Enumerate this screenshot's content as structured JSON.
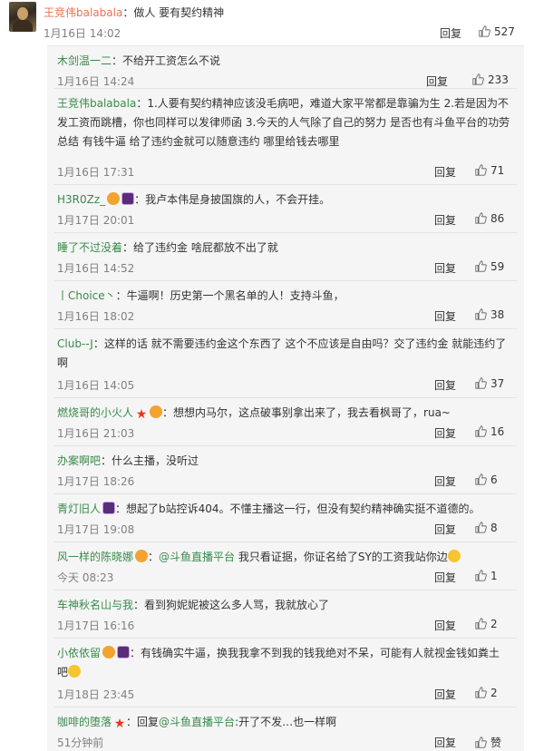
{
  "top_comment": {
    "author": "王竞伟balabala",
    "sep": "：",
    "text": "做人 要有契约精神",
    "time": "1月16日 14:02",
    "reply_label": "回复",
    "likes": "527"
  },
  "replies": [
    {
      "author": "木剑温一二",
      "sep": "：",
      "text": "不给开工资怎么不说",
      "time": "1月16日 14:24",
      "reply_label": "回复",
      "likes": "233"
    },
    {
      "author": "王竞伟balabala",
      "sep": "：",
      "text": "1.人要有契约精神应该没毛病吧，难道大家平常都是靠骗为生 2.若是因为不发工资而跳槽，你也同样可以发律师函 3.今天的人气除了自己的努力 是否也有斗鱼平台的功劳总结 有钱牛逼 给了违约金就可以随意违约 哪里给钱去哪里",
      "time": "1月16日 17:31",
      "reply_label": "回复",
      "likes": "71"
    },
    {
      "author": "H3R0Zz_",
      "sep": "：",
      "text": "我卢本伟是身披国旗的人，不会开挂。",
      "time": "1月17日 20:01",
      "reply_label": "回复",
      "likes": "86"
    },
    {
      "author": "睡了不过没着",
      "sep": "：",
      "text": "给了违约金 啥屁都放不出了就",
      "time": "1月16日 14:52",
      "reply_label": "回复",
      "likes": "59"
    },
    {
      "author": "丨Choice丶",
      "sep": "：",
      "text": "牛逼啊！历史第一个黑名单的人！支持斗鱼，",
      "time": "1月16日 18:02",
      "reply_label": "回复",
      "likes": "38"
    },
    {
      "author": "Club--J",
      "sep": "：",
      "text": "这样的话 就不需要违约金这个东西了 这个不应该是自由吗？交了违约金 就能违约了啊",
      "time": "1月16日 14:05",
      "reply_label": "回复",
      "likes": "37"
    },
    {
      "author": "燃烧哥的小火人",
      "sep": "：",
      "text": "想想内马尔，这点破事别拿出来了，我去看枫哥了，rua~",
      "time": "1月16日 21:03",
      "reply_label": "回复",
      "likes": "16"
    },
    {
      "author": "办案啊吧",
      "sep": "：",
      "text": "什么主播，没听过",
      "time": "1月17日 18:26",
      "reply_label": "回复",
      "likes": "6"
    },
    {
      "author": "青灯旧人",
      "sep": "：",
      "text": "想起了b站控诉404。不懂主播这一行，但没有契约精神确实挺不道德的。",
      "time": "1月17日 19:08",
      "reply_label": "回复",
      "likes": "8"
    },
    {
      "author": "风一样的陈晓娜",
      "sep": "：",
      "mention": "@斗鱼直播平台",
      "text": " 我只看证据，你证名给了SY的工资我站你边",
      "time": "今天 08:23",
      "reply_label": "回复",
      "likes": "1"
    },
    {
      "author": "车神秋名山与我",
      "sep": "：",
      "text": "看到狗妮妮被这么多人骂，我就放心了",
      "time": "1月17日 16:16",
      "reply_label": "回复",
      "likes": "2"
    },
    {
      "author": "小依依留",
      "sep": "：",
      "text": "有钱确实牛逼，换我我拿不到我的钱我绝对不呆，可能有人就视金钱如粪土吧",
      "time": "1月18日 23:45",
      "reply_label": "回复",
      "likes": "2"
    },
    {
      "author": "咖啡的堕落",
      "sep": "：",
      "pre": "回复",
      "mention": "@斗鱼直播平台",
      "text": ":开了不发…也一样啊",
      "time": "51分钟前",
      "reply_label": "回复",
      "likes": "赞"
    }
  ],
  "colors": {
    "name": "#eb7350",
    "reply_name": "#3a8a4a",
    "time": "#808080",
    "panel": "#f5f5f5"
  },
  "icons": [
    "thumb-up-icon",
    "crown-badge-icon",
    "vip-badge-icon",
    "star-badge-icon",
    "emoji-icon"
  ]
}
